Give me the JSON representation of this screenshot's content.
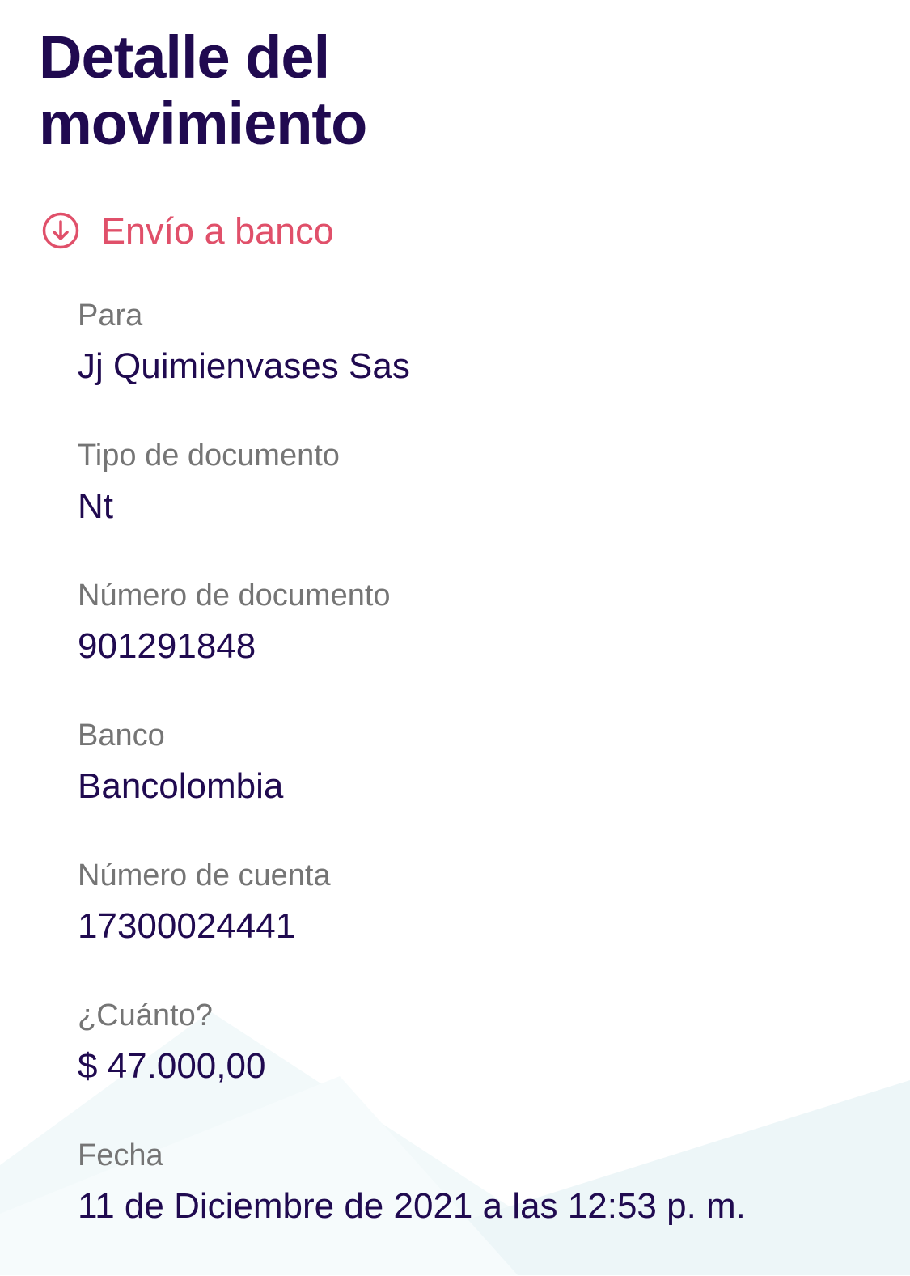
{
  "header": {
    "title_line1": "Detalle del",
    "title_line2": "movimiento"
  },
  "movement": {
    "type_label": "Envío a banco",
    "icon": "arrow-down-circle-icon",
    "accent_color": "#e0506a"
  },
  "details": [
    {
      "label": "Para",
      "value": "Jj Quimienvases Sas"
    },
    {
      "label": "Tipo de documento",
      "value": "Nt"
    },
    {
      "label": "Número de documento",
      "value": "901291848"
    },
    {
      "label": "Banco",
      "value": "Bancolombia"
    },
    {
      "label": "Número de cuenta",
      "value": "17300024441"
    },
    {
      "label": "¿Cuánto?",
      "value": "$ 47.000,00"
    },
    {
      "label": "Fecha",
      "value": "11 de Diciembre de 2021 a las 12:53 p. m."
    }
  ],
  "colors": {
    "title": "#200a50",
    "label": "#757575",
    "value": "#200a50",
    "accent": "#e0506a",
    "background": "#ffffff",
    "decor": "#eef6f8"
  }
}
